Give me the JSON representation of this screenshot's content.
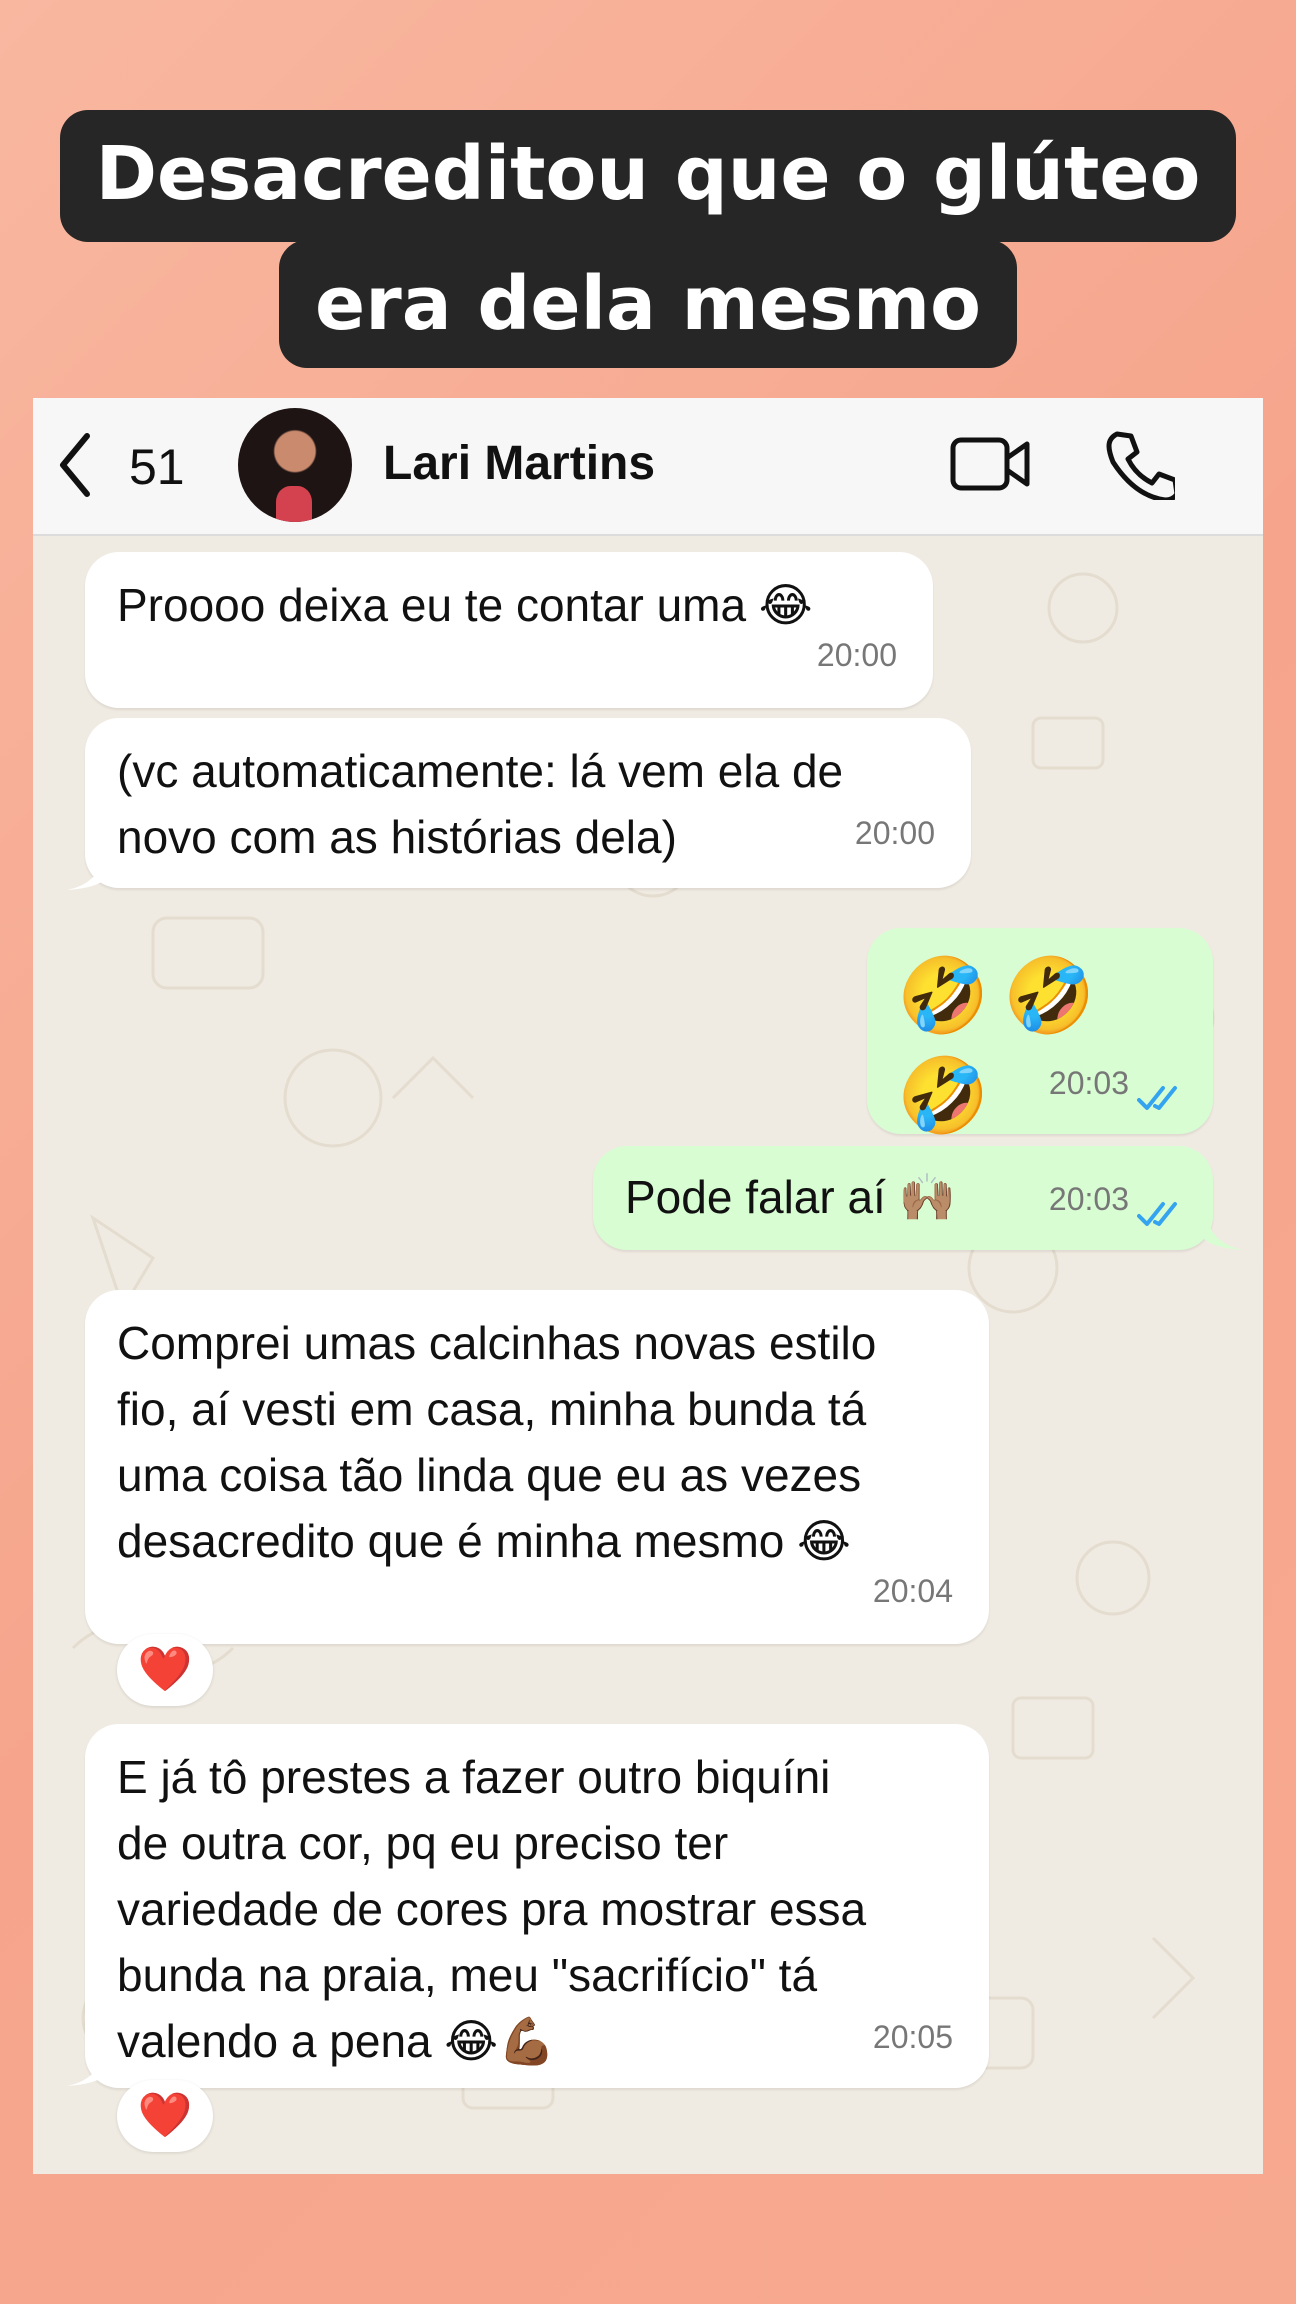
{
  "caption": {
    "line1": "Desacreditou que o glúteo",
    "line2": "era dela mesmo"
  },
  "header": {
    "unread_count": "51",
    "contact_name": "Lari Martins",
    "icons": [
      "back-chevron-icon",
      "video-call-icon",
      "phone-call-icon"
    ]
  },
  "messages": [
    {
      "direction": "in",
      "text": "Proooo deixa eu te contar uma 😂",
      "time": "20:00"
    },
    {
      "direction": "in",
      "text": "(vc automaticamente: lá vem ela de\nnovo com as histórias dela)",
      "time": "20:00"
    },
    {
      "direction": "out",
      "text": "🤣🤣🤣",
      "time": "20:03",
      "status": "read"
    },
    {
      "direction": "out",
      "text": "Pode falar aí 🙌🏽",
      "time": "20:03",
      "status": "read"
    },
    {
      "direction": "in",
      "text": "Comprei umas calcinhas novas estilo\nfio, aí vesti em casa, minha bunda tá\numa coisa tão linda que eu as vezes\ndesacredito que é minha mesmo 😂",
      "time": "20:04",
      "reaction": "❤️"
    },
    {
      "direction": "in",
      "text": "E já tô prestes a fazer outro biquíni\nde outra cor, pq eu preciso ter\nvariedade de cores pra mostrar essa\nbunda na praia, meu \"sacrifício\" tá\nvalendo a pena 😂💪🏾",
      "time": "20:05",
      "reaction": "❤️"
    }
  ],
  "colors": {
    "incoming_bubble": "#ffffff",
    "outgoing_bubble": "#d8fdd2",
    "read_ticks": "#34a4f0",
    "chat_background": "#f0ebe2"
  }
}
